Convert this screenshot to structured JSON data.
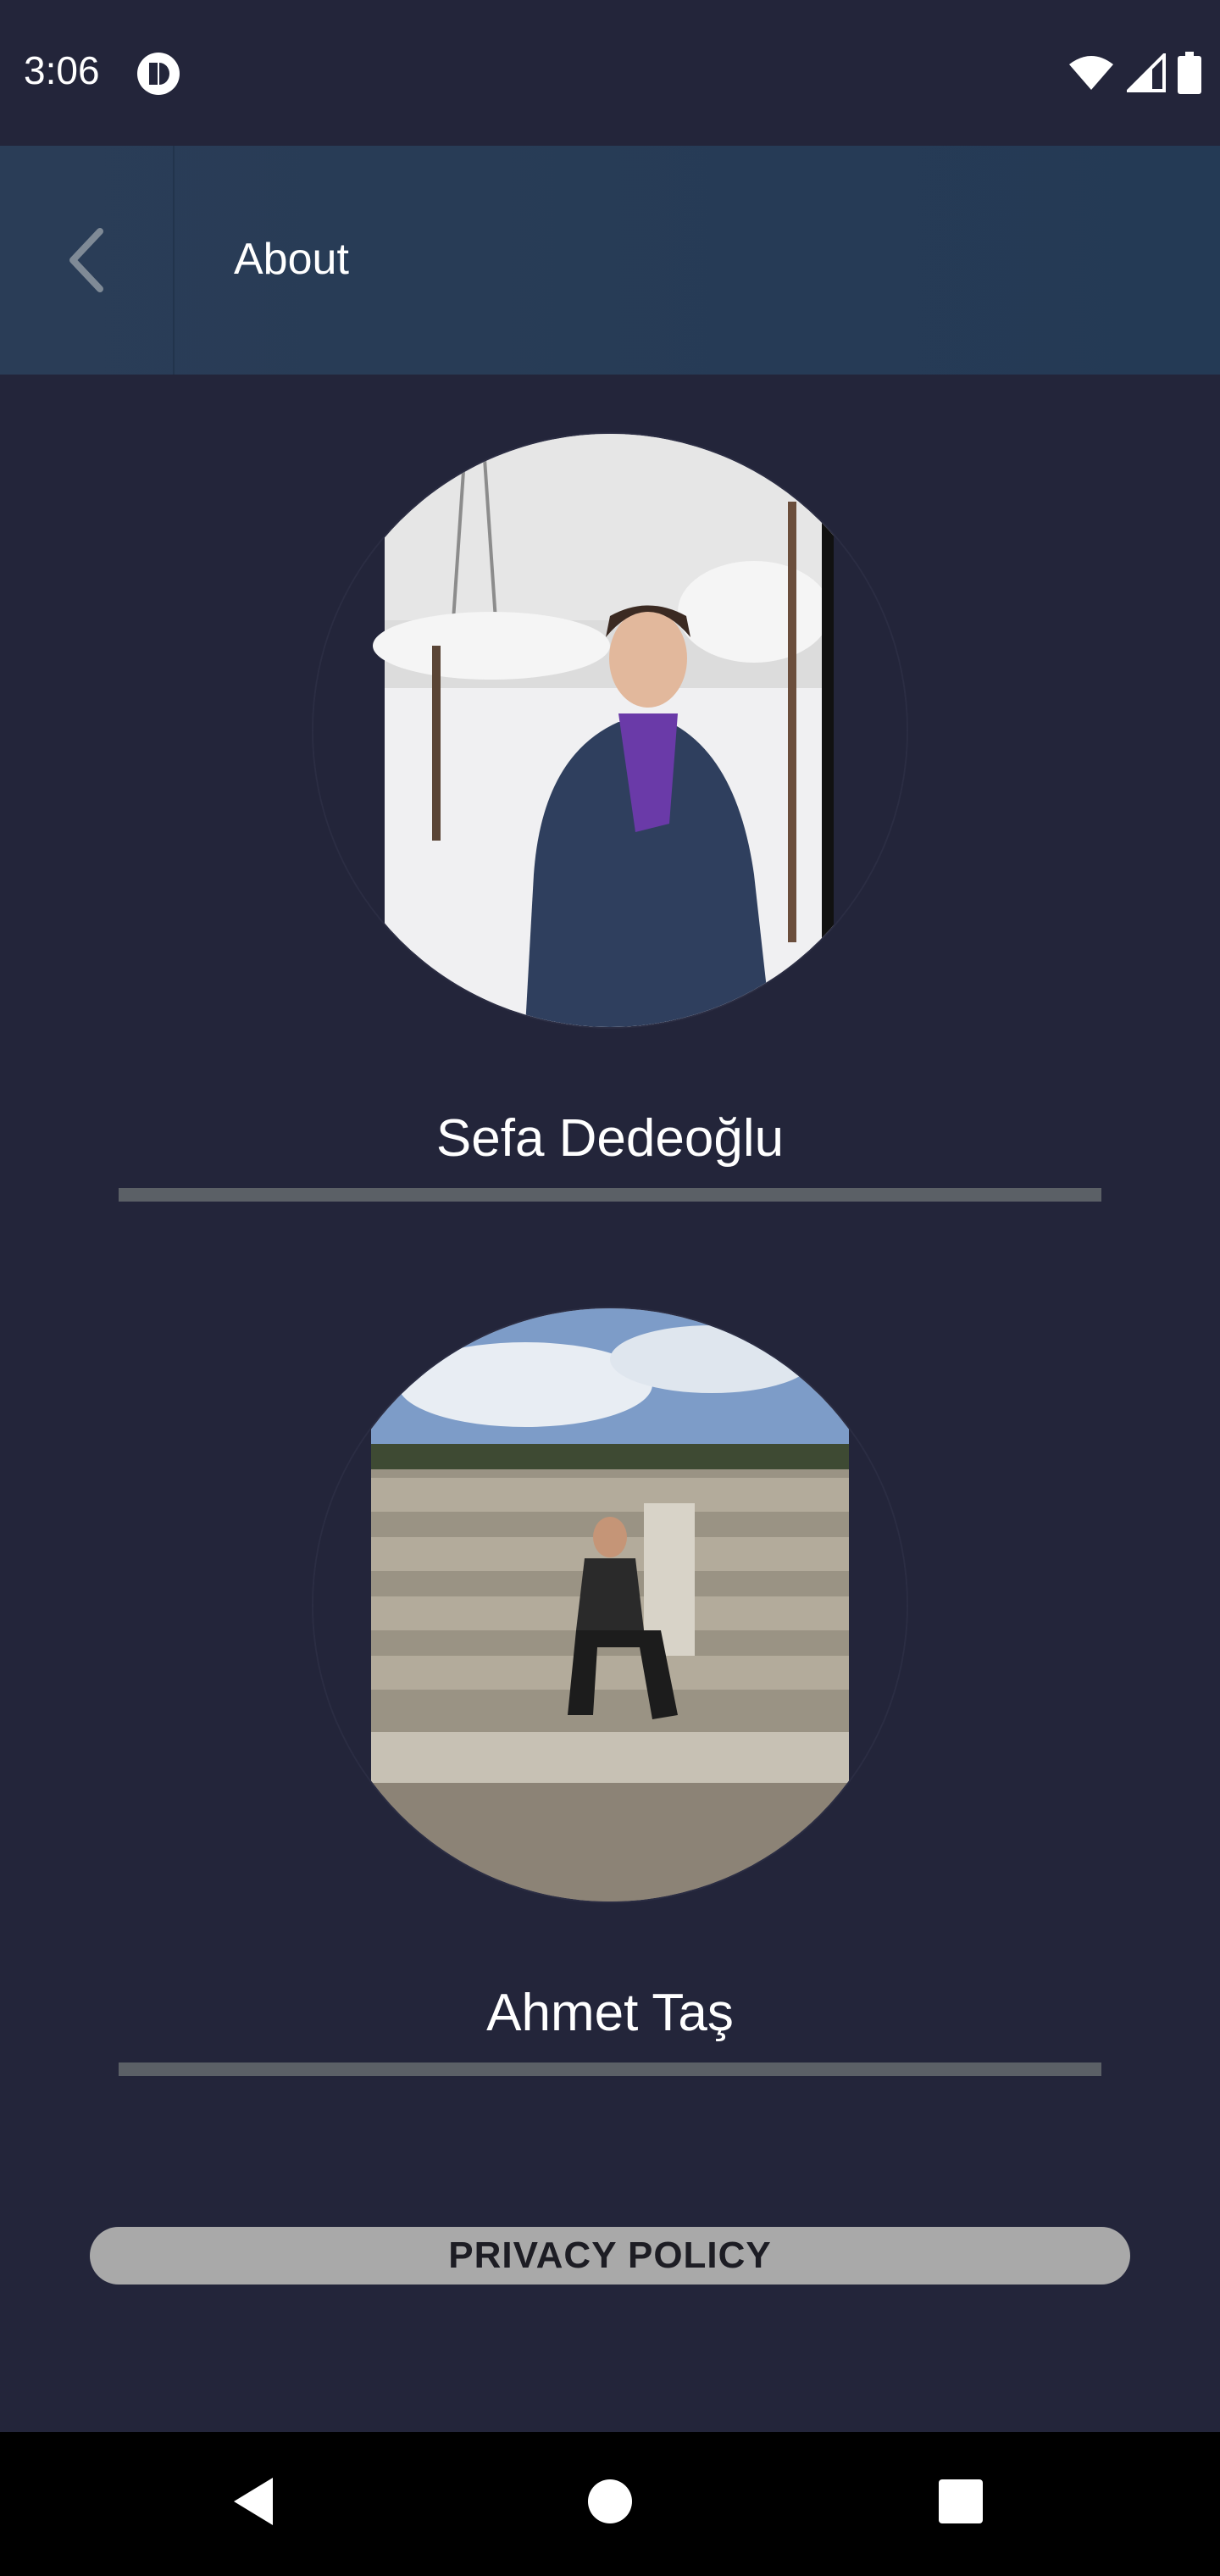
{
  "status_bar": {
    "time": "3:06",
    "app_icon": "app-notification-icon",
    "icons": [
      "wifi-icon",
      "cell-signal-icon",
      "battery-icon"
    ]
  },
  "app_bar": {
    "back_icon": "chevron-left-icon",
    "title": "About",
    "background_color": "#243a55"
  },
  "profiles": [
    {
      "name": "Sefa Dedeoğlu",
      "photo": "snowy-vineyard-portrait"
    },
    {
      "name": "Ahmet Taş",
      "photo": "ancient-stone-theatre-portrait"
    }
  ],
  "privacy_button": {
    "label": "PRIVACY POLICY"
  },
  "nav_bar": {
    "icons": [
      "back-triangle-icon",
      "home-circle-icon",
      "recents-square-icon"
    ]
  },
  "colors": {
    "background": "#23253a",
    "divider": "#5b6066",
    "button": "#a9a9a9"
  }
}
